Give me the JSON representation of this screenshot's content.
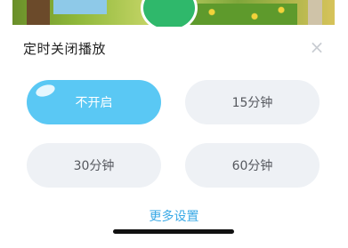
{
  "sheet": {
    "title": "定时关闭播放",
    "close_icon": "close-icon",
    "close_glyph": "×"
  },
  "options": [
    {
      "label": "不开启",
      "selected": true
    },
    {
      "label": "15分钟",
      "selected": false
    },
    {
      "label": "30分钟",
      "selected": false
    },
    {
      "label": "60分钟",
      "selected": false
    }
  ],
  "more_settings": "更多设置",
  "colors": {
    "accent": "#5ac8f4",
    "option_bg": "#eef1f5",
    "link": "#3aa9e6"
  }
}
